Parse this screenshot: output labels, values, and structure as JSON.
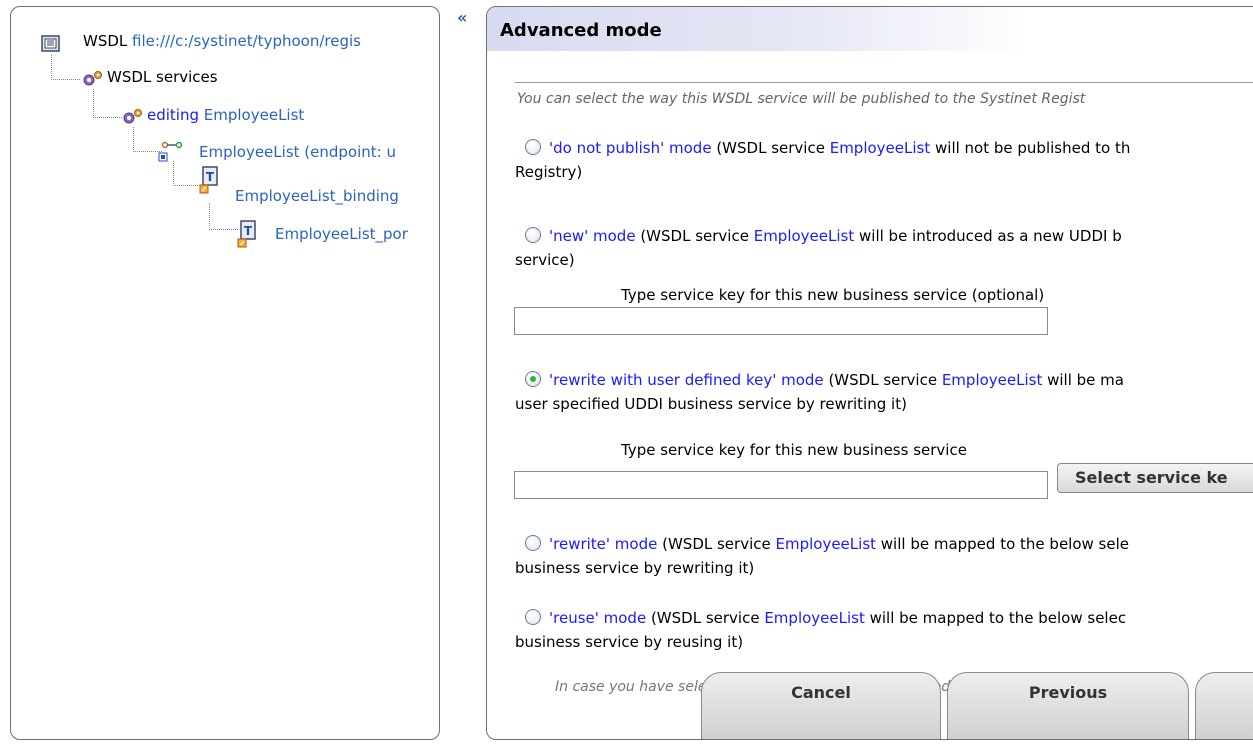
{
  "tree": {
    "root_prefix": "WSDL",
    "root_link": "file:///c:/systinet/typhoon/regis",
    "services_label": "WSDL services",
    "editing_prefix": "editing",
    "editing_name": "EmployeeList",
    "endpoint_label": "EmployeeList (endpoint: u",
    "binding_label": "EmployeeList_binding",
    "port_label": "EmployeeList_por"
  },
  "collapse_glyph": "«",
  "panel": {
    "title": "Advanced mode",
    "intro": "You can select the way this WSDL service will be published to the Systinet Regist",
    "service_name": "EmployeeList",
    "options": [
      {
        "mode": "'do not publish' mode",
        "pre": " (WSDL service ",
        "post": " will not be published to th",
        "line2": "Registry)",
        "checked": false
      },
      {
        "mode": "'new' mode",
        "pre": " (WSDL service ",
        "post": " will be introduced as a new UDDI b",
        "line2": "service)",
        "checked": false
      },
      {
        "mode": "'rewrite with user defined key' mode",
        "pre": " (WSDL service ",
        "post": " will be ma",
        "line2": "user specified UDDI business service by rewriting it)",
        "checked": true
      },
      {
        "mode": "'rewrite' mode",
        "pre": " (WSDL service ",
        "post": " will be mapped to the below sele",
        "line2": "business service by rewriting it)",
        "checked": false
      },
      {
        "mode": "'reuse' mode",
        "pre": " (WSDL service ",
        "post": " will be mapped to the below selec",
        "line2": "business service by reusing it)",
        "checked": false
      }
    ],
    "new_key_label": "Type service key for this new business service (optional)",
    "new_key_value": "",
    "user_key_label": "Type service key for this new business service",
    "user_key_value": "",
    "select_button": "Select service ke",
    "faded_text": "In case you have selected either 'rewrite' or 'reuse' mode, use the followin",
    "buttons": {
      "cancel": "Cancel",
      "previous": "Previous",
      "next": ""
    }
  },
  "colors": {
    "link": "#2a64c0",
    "mode_link": "#1a1aff",
    "header": "#d8daf0"
  }
}
